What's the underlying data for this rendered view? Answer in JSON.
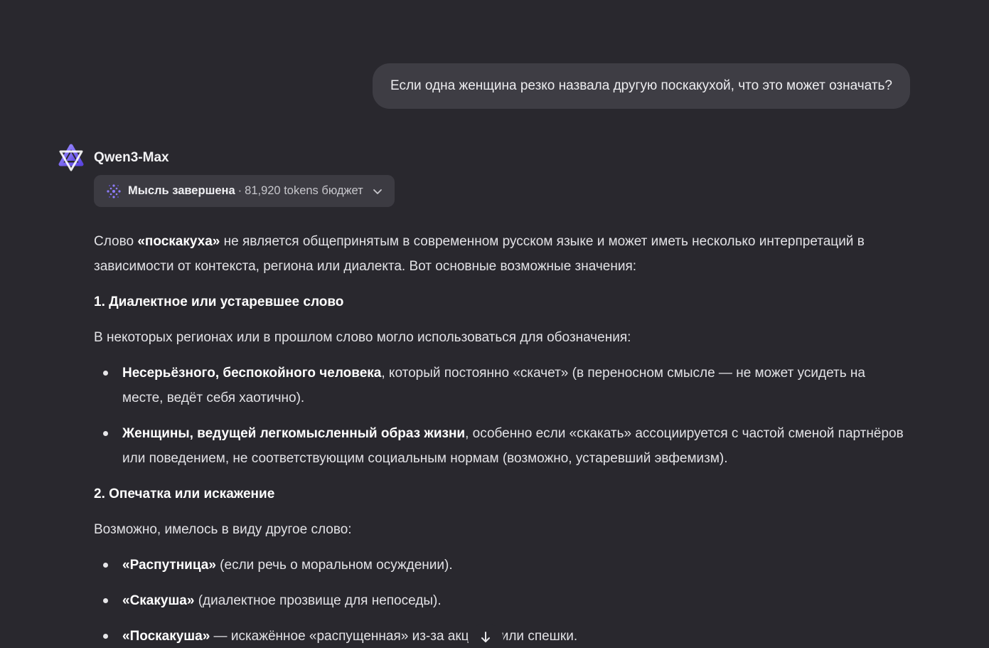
{
  "user_message": "Если одна женщина резко назвала другую поскакухой, что это может означать?",
  "assistant": {
    "model_name": "Qwen3-Max",
    "avatar_icon": "qwen-logo-icon",
    "accent_color": "#7c6cf0",
    "thought": {
      "status": "Мысль завершена",
      "separator": "·",
      "budget": "81,920 tokens бюджет",
      "icon": "sparkle-icon",
      "toggle_icon": "chevron-down-icon"
    }
  },
  "answer": {
    "intro": {
      "before": "Слово ",
      "bold": "«поскакуха»",
      "after": " не является общепринятым в современном русском языке и может иметь несколько интерпретаций в зависимости от контекста, региона или диалекта. Вот основные возможные значения:"
    },
    "section1": {
      "heading": "1. Диалектное или устаревшее слово",
      "lead": "В некоторых регионах или в прошлом слово могло использоваться для обозначения:",
      "items": [
        {
          "bold": "Несерьёзного, беспокойного человека",
          "text": ", который постоянно «скачет» (в переносном смысле — не может усидеть на месте, ведёт себя хаотично)."
        },
        {
          "bold": "Женщины, ведущей легкомысленный образ жизни",
          "text": ", особенно если «скакать» ассоциируется с частой сменой партнёров или поведением, не соответствующим социальным нормам (возможно, устаревший эвфемизм)."
        }
      ]
    },
    "section2": {
      "heading": "2. Опечатка или искажение",
      "lead": "Возможно, имелось в виду другое слово:",
      "items": [
        {
          "bold": "«Распутница»",
          "text": " (если речь о моральном осуждении)."
        },
        {
          "bold": "«Скакуша»",
          "text": " (диалектное прозвище для непоседы)."
        },
        {
          "bold": "«Поскакуша»",
          "text": " — искажённое «распущенная» из-за акцента или спешки."
        }
      ]
    }
  },
  "scroll_button_icon": "arrow-down-icon"
}
